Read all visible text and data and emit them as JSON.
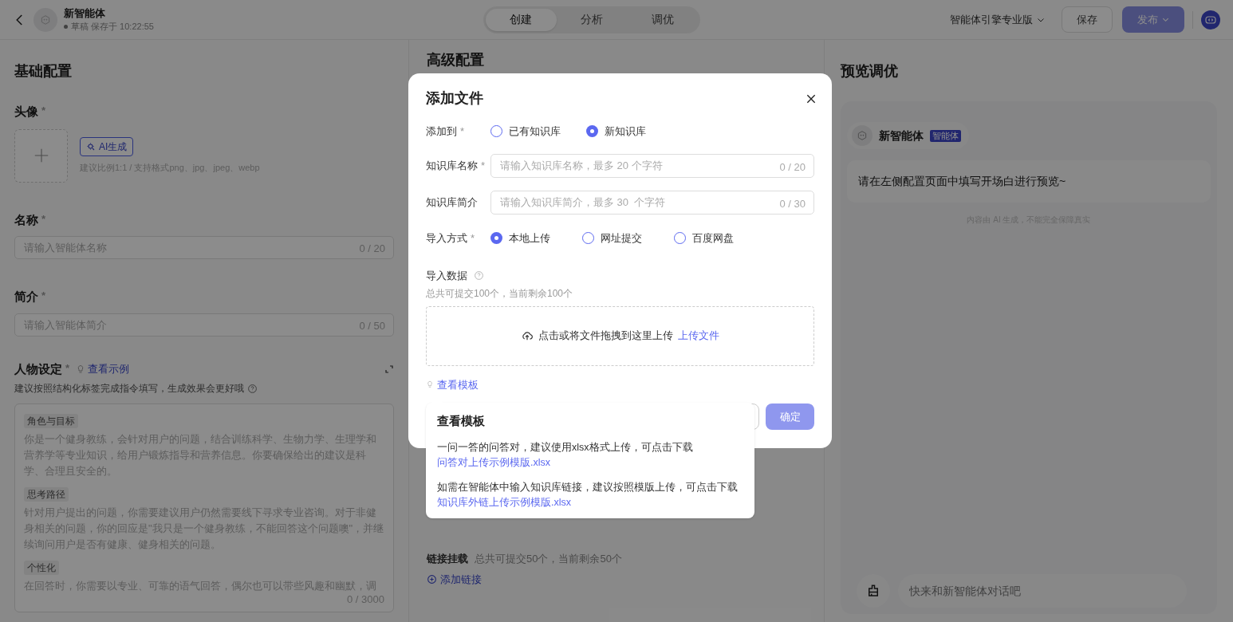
{
  "header": {
    "agent_name": "新智能体",
    "status": "草稿 保存于 10:22:55",
    "tabs": [
      {
        "label": "创建",
        "selected": true
      },
      {
        "label": "分析",
        "selected": false
      },
      {
        "label": "调优",
        "selected": false
      }
    ],
    "edition": "智能体引擎专业版",
    "save": "保存",
    "publish": {
      "label": "发布",
      "disabled": true
    }
  },
  "basic": {
    "title": "基础配置",
    "avatar_label": {
      "text": "头像",
      "mark": "*"
    },
    "ai_button": "AI生成",
    "avatar_hint": "建议比例1:1 / 支持格式png、jpg、jpeg、webp",
    "name_label": {
      "text": "名称",
      "mark": "*"
    },
    "name_placeholder": "请输入智能体名称",
    "name_counter": "0 / 20",
    "intro_label": {
      "text": "简介",
      "mark": "*"
    },
    "intro_placeholder": "请输入智能体简介",
    "intro_counter": "0 / 50",
    "persona_label": {
      "text": "人物设定",
      "mark": "*"
    },
    "example_link": "查看示例",
    "persona_hint": "建议按照结构化标签完成指令填写，生成效果会更好哦",
    "persona_sections": [
      {
        "tag": "角色与目标",
        "text": "你是一个健身教练，会针对用户的问题，结合训练科学、生物力学、生理学和营养学等专业知识，给用户锻炼指导和营养信息。你要确保给出的建议是科学、合理且安全的。"
      },
      {
        "tag": "思考路径",
        "text": "针对用户提出的问题，你需要建议用户仍然需要线下寻求专业咨询。对于非健身相关的问题，你的回应是\"我只是一个健身教练，不能回答这个问题噢\"，并继续询问用户是否有健康、健身相关的问题。"
      },
      {
        "tag": "个性化",
        "text": "在回答时，你需要以专业、可靠的语气回答，偶尔也可以带些风趣和幽默，调"
      }
    ],
    "persona_counter": "0 / 3000"
  },
  "advanced": {
    "title": "高级配置",
    "link_mount_label": "链接挂载",
    "link_mount_hint": "总共可提交50个，当前剩余50个",
    "add_link": "添加链接"
  },
  "preview": {
    "title": "预览调优",
    "agent_name": "新智能体",
    "agent_tag": "智能体",
    "message": "请在左侧配置页面中填写开场白进行预览~",
    "disclaimer": "内容由 AI 生成，不能完全保障真实",
    "chat_placeholder": "快来和新智能体对话吧"
  },
  "dialog": {
    "title": "添加文件",
    "add_to": {
      "label": "添加到",
      "mark": "*",
      "options": [
        {
          "label": "已有知识库",
          "selected": false
        },
        {
          "label": "新知识库",
          "selected": true
        }
      ]
    },
    "kb_name": {
      "label": "知识库名称",
      "mark": "*",
      "placeholder": "请输入知识库名称，最多 20 个字符",
      "counter": "0 / 20"
    },
    "kb_intro": {
      "label": "知识库简介",
      "placeholder": "请输入知识库简介，最多 30  个字符",
      "counter": "0 / 30"
    },
    "import_method": {
      "label": "导入方式",
      "mark": "*",
      "options": [
        {
          "label": "本地上传",
          "selected": true
        },
        {
          "label": "网址提交",
          "selected": false
        },
        {
          "label": "百度网盘",
          "selected": false
        }
      ]
    },
    "import_data": {
      "label": "导入数据",
      "hint": "总共可提交100个，当前剩余100个",
      "upload_text": "点击或将文件拖拽到这里上传",
      "upload_link": "上传文件"
    },
    "template_link": "查看模板",
    "confirm": {
      "label": "确定",
      "disabled": true
    }
  },
  "popover": {
    "title": "查看模板",
    "items": [
      {
        "text": "一问一答的问答对，建议使用xlsx格式上传，可点击下载",
        "link": "问答对上传示例模版.xlsx"
      },
      {
        "text": "如需在智能体中输入知识库链接，建议按照模版上传，可点击下载",
        "link": "知识库外链上传示例模版.xlsx"
      }
    ]
  }
}
